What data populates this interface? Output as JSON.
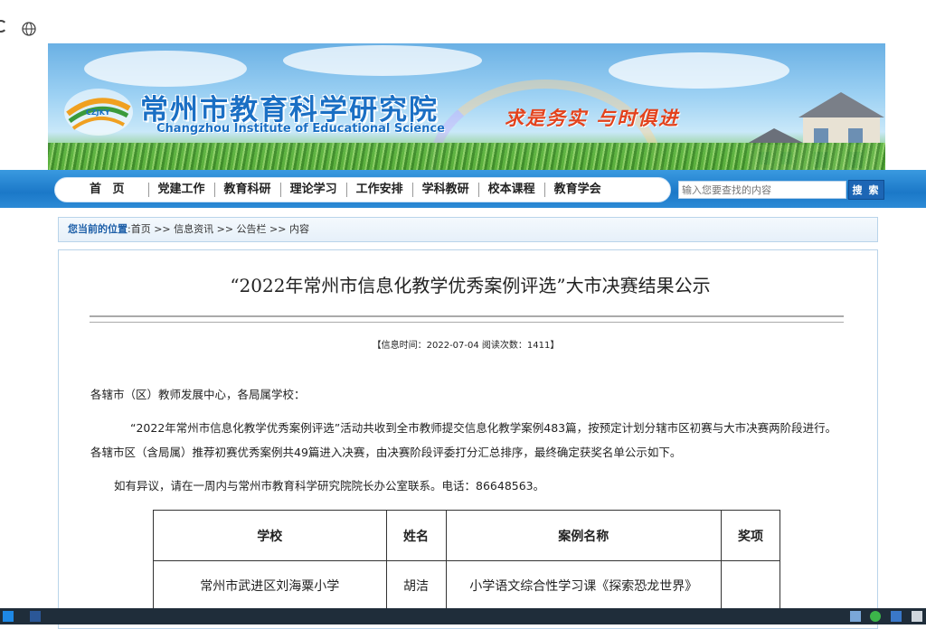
{
  "banner": {
    "title_cn": "常州市教育科学研究院",
    "title_en": "Changzhou Institute of Educational Science",
    "logo_text": "CZJKY",
    "slogan": "求是务实  与时俱进"
  },
  "nav": {
    "items": [
      "首 页",
      "党建工作",
      "教育科研",
      "理论学习",
      "工作安排",
      "学科教研",
      "校本课程",
      "教育学会"
    ],
    "search_placeholder": "输入您要查找的内容",
    "search_button": "搜 索"
  },
  "breadcrumb": {
    "lead": "您当前的位置",
    "path": ":首页 >> 信息资讯 >> 公告栏 >> 内容"
  },
  "article": {
    "title": "“2022年常州市信息化教学优秀案例评选”大市决赛结果公示",
    "meta": "【信息时间：2022-07-04    阅读次数：1411】",
    "p1": "各辖市（区）教师发展中心，各局属学校：",
    "p2": "“2022年常州市信息化教学优秀案例评选”活动共收到全市教师提交信息化教学案例483篇，按预定计划分辖市区初赛与大市决赛两阶段进行。各辖市区（含局属）推荐初赛优秀案例共49篇进入决赛，由决赛阶段评委打分汇总排序，最终确定获奖名单公示如下。",
    "p3": "如有异议，请在一周内与常州市教育科学研究院院长办公室联系。电话：86648563。"
  },
  "table": {
    "headers": [
      "学校",
      "姓名",
      "案例名称",
      "奖项"
    ],
    "rows": [
      [
        "常州市武进区刘海粟小学",
        "胡洁",
        "小学语文综合性学习课《探索恐龙世界》",
        ""
      ]
    ]
  },
  "colors": {
    "nav_blue": "#1b78c8",
    "title_blue": "#1a6fc4",
    "slogan_red": "#e3421c",
    "search_button": "#1d66b5"
  }
}
